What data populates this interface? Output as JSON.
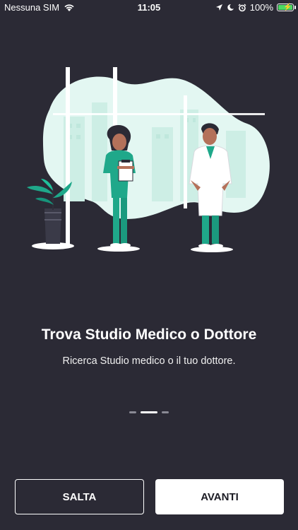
{
  "status_bar": {
    "carrier": "Nessuna SIM",
    "time": "11:05",
    "battery": "100%"
  },
  "onboarding": {
    "title": "Trova Studio Medico o Dottore",
    "subtitle": "Ricerca Studio medico o il tuo dottore.",
    "page_index": 2,
    "page_count": 3
  },
  "buttons": {
    "skip_label": "SALTA",
    "next_label": "AVANTI"
  },
  "colors": {
    "background": "#2b2a35",
    "accent_teal": "#1fa88a",
    "illustration_bg": "#e3f7f2"
  }
}
